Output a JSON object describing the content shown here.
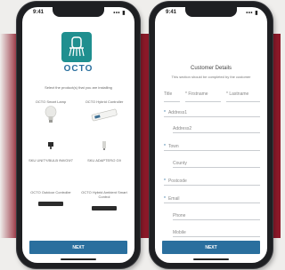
{
  "left_screen": {
    "status_time": "9:41",
    "status_signal": "••• ▮",
    "logo_text": "OCTO",
    "select_text": "Select the product(s) that you are installing",
    "products": [
      {
        "label": "OCTO Smart Lamp",
        "icon": "bulb-icon"
      },
      {
        "label": "OCTO Hybrid Controller",
        "icon": "controller-icon"
      },
      {
        "label": "SKU UNITY/BULB 9W/G9/7",
        "icon": "lamp-base-icon"
      },
      {
        "label": "SKU ADAPTER/2 G9",
        "icon": "adapter-icon"
      },
      {
        "label": "OCTO Outdoor Controller",
        "icon": "outdoor-controller-icon"
      },
      {
        "label": "OCTO Hybrid Ambient Smart Control",
        "icon": "ambient-controller-icon"
      }
    ],
    "next_label": "NEXT"
  },
  "right_screen": {
    "status_time": "9:41",
    "status_signal": "••• ▮",
    "title": "Customer Details",
    "subtitle": "This section should be completed by the customer",
    "name_row": {
      "title": "Title",
      "first": "* Firstname",
      "last": "* Lastname"
    },
    "fields": [
      {
        "label": "Address1",
        "required": true
      },
      {
        "label": "Address2",
        "required": false
      },
      {
        "label": "Town",
        "required": true
      },
      {
        "label": "County",
        "required": false
      },
      {
        "label": "Postcode",
        "required": true
      },
      {
        "label": "Email",
        "required": true
      },
      {
        "label": "Phone",
        "required": false
      },
      {
        "label": "Mobile",
        "required": false
      }
    ],
    "next_label": "NEXT"
  },
  "colors": {
    "brand_red": "#8e1a2a",
    "primary_blue": "#2a6f9e",
    "logo_teal": "#1f8f8f"
  }
}
